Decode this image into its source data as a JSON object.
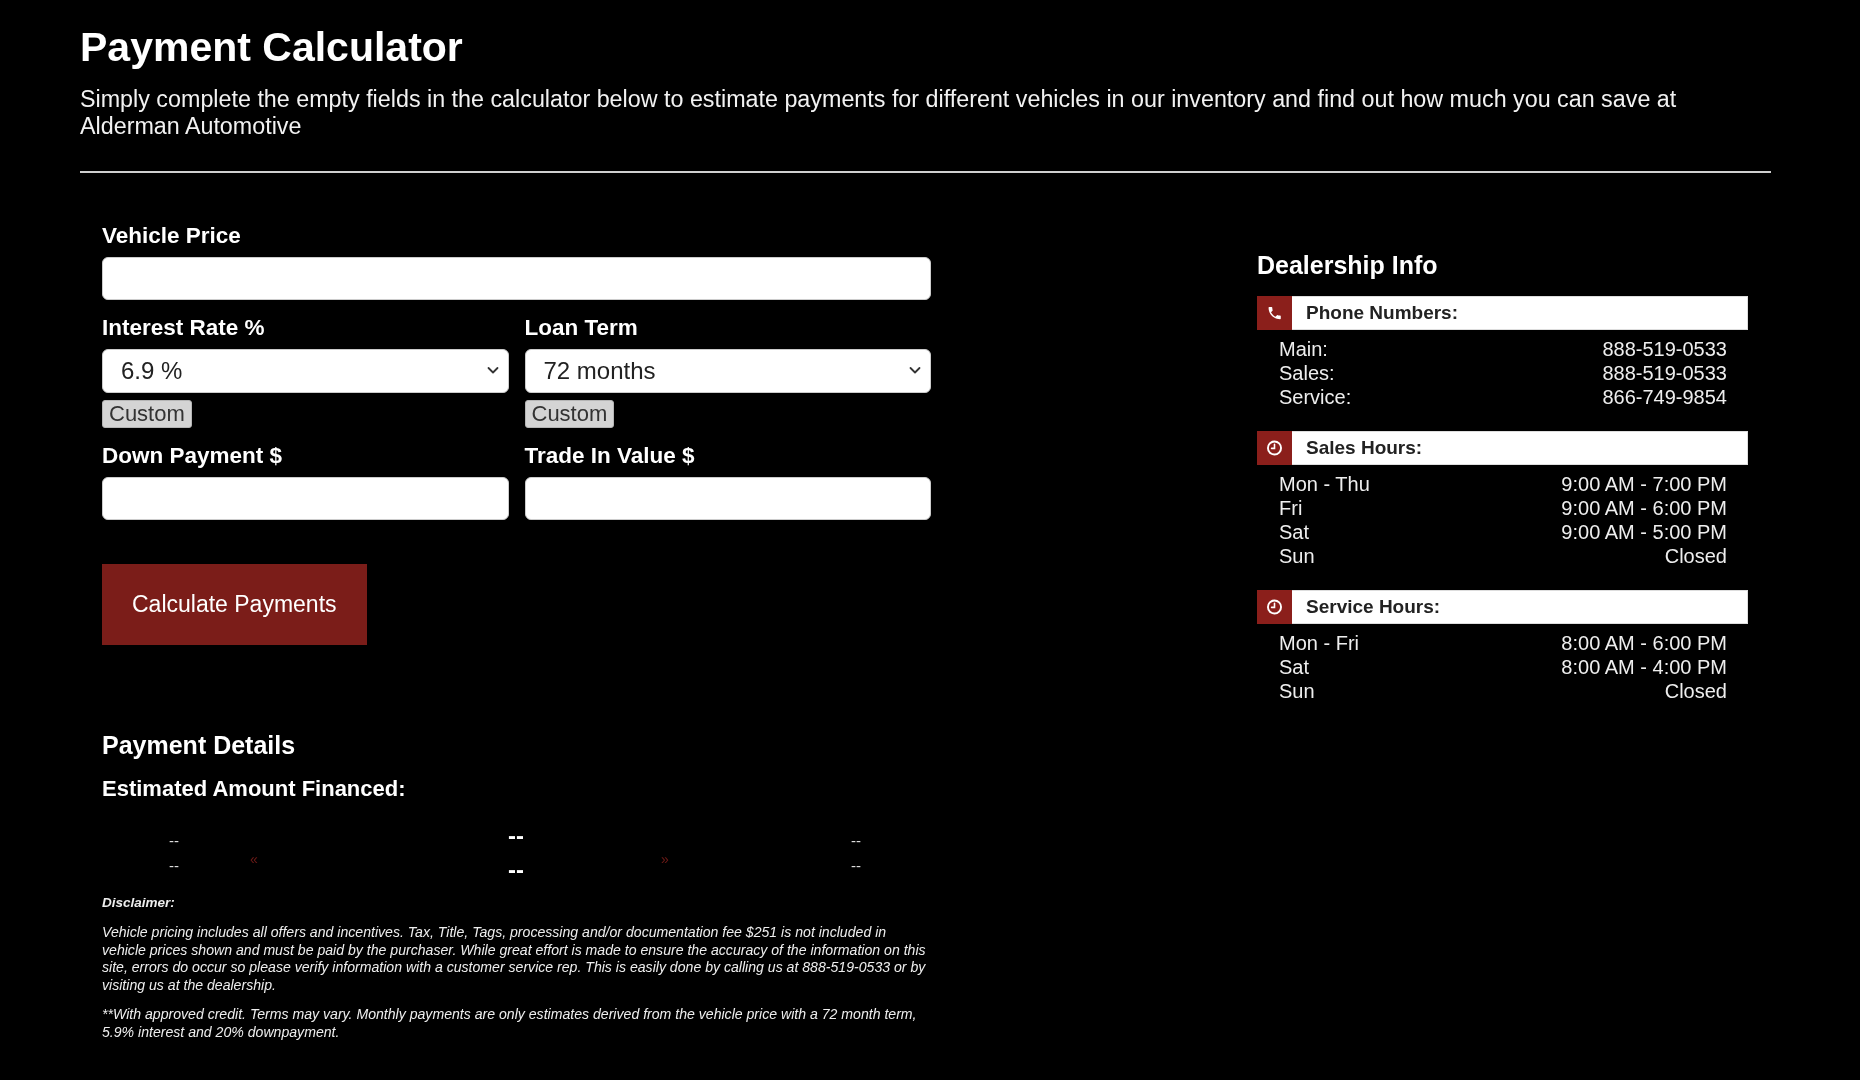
{
  "page": {
    "title": "Payment Calculator",
    "intro": "Simply complete the empty fields in the calculator below to estimate payments for different vehicles in our inventory and find out how much you can save at Alderman Automotive"
  },
  "calculator": {
    "field_rows": [
      {
        "fields": [
          {
            "label": "Vehicle Price",
            "kind": "text"
          }
        ]
      },
      {
        "fields": [
          {
            "label": "Interest Rate %",
            "kind": "select",
            "value": "6.9 %",
            "custom_button": "Custom"
          },
          {
            "label": "Loan Term",
            "kind": "select",
            "value": "72 months",
            "custom_button": "Custom"
          }
        ]
      },
      {
        "fields": [
          {
            "label": "Down Payment $",
            "kind": "text"
          },
          {
            "label": "Trade In Value $",
            "kind": "text"
          }
        ]
      }
    ],
    "submit_button": "Calculate Payments"
  },
  "payment_details": {
    "title": "Payment Details",
    "financed_label": "Estimated Amount Financed:",
    "summary": {
      "left": [
        "--",
        "--"
      ],
      "previous": "«",
      "center": [
        "--",
        "--"
      ],
      "next": "»",
      "right": [
        "--",
        "--"
      ]
    }
  },
  "disclaimer": {
    "title": "Disclaimer:",
    "paragraphs": [
      "Vehicle pricing includes all offers and incentives. Tax, Title, Tags, processing and/or documentation fee $251 is not included in vehicle prices shown and must be paid by the purchaser. While great effort is made to ensure the accuracy of the information on this site, errors do occur so please verify information with a customer service rep. This is easily done by calling us at 888-519-0533 or by visiting us at the dealership.",
      "**With approved credit. Terms may vary. Monthly payments are only estimates derived from the vehicle price with a 72 month term, 5.9% interest and 20% downpayment."
    ]
  },
  "dealership_info": {
    "title": "Dealership Info",
    "sections": [
      {
        "kind": "phone",
        "title": "Phone Numbers:",
        "rows": [
          {
            "label": "Main:",
            "value": "888-519-0533"
          },
          {
            "label": "Sales:",
            "value": "888-519-0533"
          },
          {
            "label": "Service:",
            "value": "866-749-9854"
          }
        ]
      },
      {
        "kind": "clock",
        "title": "Sales Hours:",
        "rows": [
          {
            "label": "Mon - Thu",
            "value": "9:00 AM - 7:00 PM"
          },
          {
            "label": "Fri",
            "value": "9:00 AM - 6:00 PM"
          },
          {
            "label": "Sat",
            "value": "9:00 AM - 5:00 PM"
          },
          {
            "label": "Sun",
            "value": "Closed"
          }
        ]
      },
      {
        "kind": "clock",
        "title": "Service Hours:",
        "rows": [
          {
            "label": "Mon - Fri",
            "value": "8:00 AM - 6:00 PM"
          },
          {
            "label": "Sat",
            "value": "8:00 AM - 4:00 PM"
          },
          {
            "label": "Sun",
            "value": "Closed"
          }
        ]
      }
    ]
  }
}
